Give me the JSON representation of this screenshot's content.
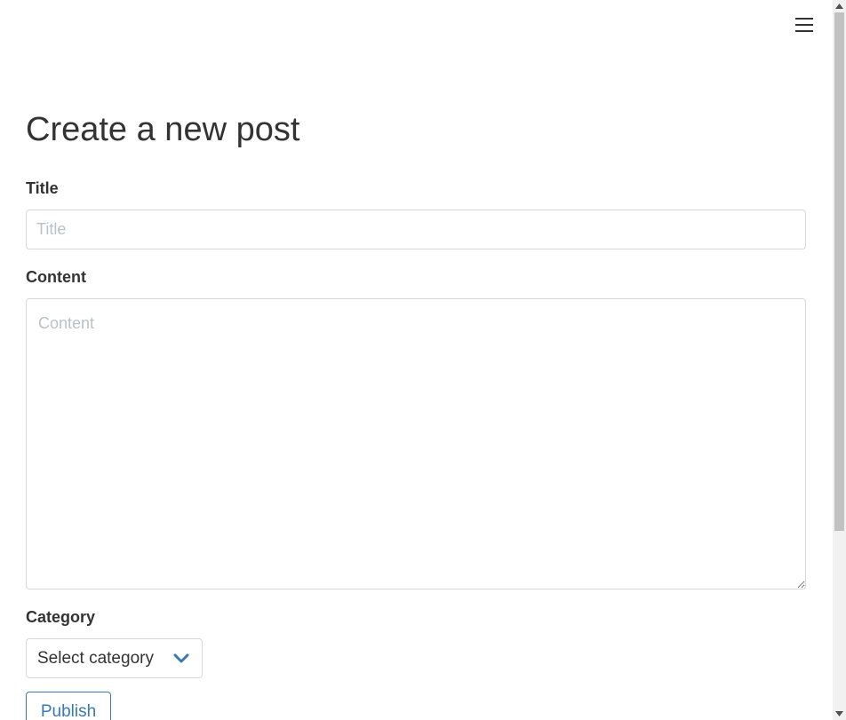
{
  "page": {
    "title": "Create a new post"
  },
  "form": {
    "title_label": "Title",
    "title_placeholder": "Title",
    "title_value": "",
    "content_label": "Content",
    "content_placeholder": "Content",
    "content_value": "",
    "category_label": "Category",
    "category_selected": "Select category",
    "publish_label": "Publish"
  },
  "icons": {
    "menu": "hamburger-menu-icon",
    "select_chevron": "chevron-down-icon",
    "scroll_up": "triangle-up-icon",
    "scroll_down": "triangle-down-icon"
  },
  "colors": {
    "text": "#333333",
    "accent": "#3a78b5",
    "border": "#d8d8d8",
    "placeholder": "#b9c2c8"
  }
}
